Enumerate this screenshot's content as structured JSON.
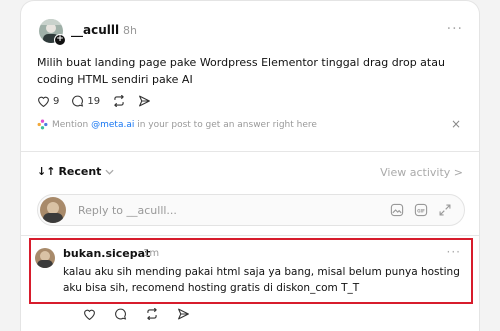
{
  "post": {
    "username": "__aculll",
    "time": "8h",
    "text": "Milih buat landing page pake Wordpress Elementor tinggal drag drop atau coding HTML sendiri pake AI",
    "like_count": "9",
    "comment_count": "19",
    "icons": [
      "heart-icon",
      "comment-icon",
      "repost-icon",
      "share-icon"
    ]
  },
  "mention": {
    "prefix": "Mention ",
    "handle": "@meta.ai",
    "suffix": " in your post to get an answer right here",
    "close": "×"
  },
  "sort": {
    "label": "Recent",
    "arrows": "↓↑",
    "view_activity": "View activity >"
  },
  "reply": {
    "placeholder": "Reply to __aculll...",
    "icons": [
      "image-icon",
      "gif-icon",
      "expand-icon"
    ]
  },
  "comment": {
    "username": "bukan.sicepat",
    "time": "1m",
    "text": "kalau aku sih mending pakai html saja ya bang, misal belum punya hosting aku bisa sih, recomend hosting gratis di diskon_com T_T"
  },
  "more_glyph": "···",
  "colors": {
    "highlight_border": "#d71c2c",
    "link": "#1877f2"
  }
}
